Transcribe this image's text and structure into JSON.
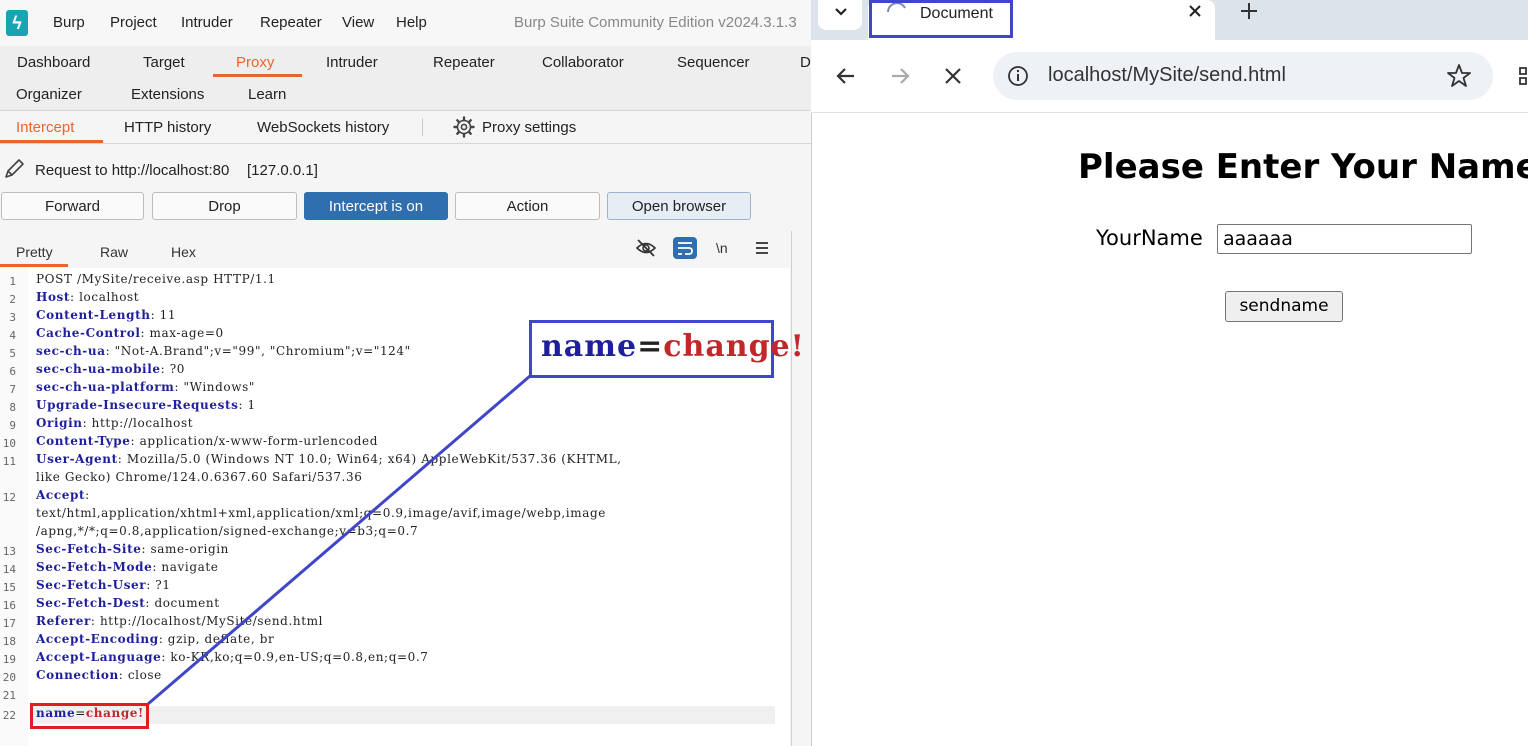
{
  "burp": {
    "title": "Burp Suite Community Edition v2024.3.1.3",
    "menu": [
      "Burp",
      "Project",
      "Intruder",
      "Repeater",
      "View",
      "Help"
    ],
    "main_tabs_row1": [
      "Dashboard",
      "Target",
      "Proxy",
      "Intruder",
      "Repeater",
      "Collaborator",
      "Sequencer",
      "D"
    ],
    "main_tabs_row2": [
      "Organizer",
      "Extensions",
      "Learn"
    ],
    "active_main_tab": "Proxy",
    "sub_tabs": [
      "Intercept",
      "HTTP history",
      "WebSockets history"
    ],
    "proxy_settings": "Proxy settings",
    "request_to": "Request to http://localhost:80",
    "request_ip": "[127.0.0.1]",
    "buttons": {
      "forward": "Forward",
      "drop": "Drop",
      "intercept": "Intercept is on",
      "action": "Action",
      "open_browser": "Open browser"
    },
    "editor_tabs": [
      "Pretty",
      "Raw",
      "Hex"
    ],
    "newline_toggle": "\\n",
    "request_lines": [
      {
        "n": "1",
        "text": "POST /MySite/receive.asp HTTP/1.1"
      },
      {
        "n": "2",
        "key": "Host",
        "val": "localhost"
      },
      {
        "n": "3",
        "key": "Content-Length",
        "val": "11"
      },
      {
        "n": "4",
        "key": "Cache-Control",
        "val": "max-age=0"
      },
      {
        "n": "5",
        "key": "sec-ch-ua",
        "val": "\"Not-A.Brand\";v=\"99\", \"Chromium\";v=\"124\""
      },
      {
        "n": "6",
        "key": "sec-ch-ua-mobile",
        "val": "?0"
      },
      {
        "n": "7",
        "key": "sec-ch-ua-platform",
        "val": "\"Windows\""
      },
      {
        "n": "8",
        "key": "Upgrade-Insecure-Requests",
        "val": "1"
      },
      {
        "n": "9",
        "key": "Origin",
        "val": "http://localhost"
      },
      {
        "n": "10",
        "key": "Content-Type",
        "val": "application/x-www-form-urlencoded"
      },
      {
        "n": "11",
        "key": "User-Agent",
        "val": "Mozilla/5.0 (Windows NT 10.0; Win64; x64) AppleWebKit/537.36 (KHTML,"
      },
      {
        "n": "",
        "text": "like Gecko) Chrome/124.0.6367.60 Safari/537.36"
      },
      {
        "n": "12",
        "key": "Accept",
        "val": ""
      },
      {
        "n": "",
        "text": "text/html,application/xhtml+xml,application/xml;q=0.9,image/avif,image/webp,image"
      },
      {
        "n": "",
        "text": "/apng,*/*;q=0.8,application/signed-exchange;v=b3;q=0.7"
      },
      {
        "n": "13",
        "key": "Sec-Fetch-Site",
        "val": "same-origin"
      },
      {
        "n": "14",
        "key": "Sec-Fetch-Mode",
        "val": "navigate"
      },
      {
        "n": "15",
        "key": "Sec-Fetch-User",
        "val": "?1"
      },
      {
        "n": "16",
        "key": "Sec-Fetch-Dest",
        "val": "document"
      },
      {
        "n": "17",
        "key": "Referer",
        "val": "http://localhost/MySite/send.html"
      },
      {
        "n": "18",
        "key": "Accept-Encoding",
        "val": "gzip, deflate, br"
      },
      {
        "n": "19",
        "key": "Accept-Language",
        "val": "ko-KR,ko;q=0.9,en-US;q=0.8,en;q=0.7"
      },
      {
        "n": "20",
        "key": "Connection",
        "val": "close"
      },
      {
        "n": "21",
        "text": ""
      }
    ],
    "body_line": {
      "n": "22",
      "param": "name",
      "eq": "=",
      "value": "change!"
    },
    "zoom_callout": {
      "param": "name",
      "eq": "=",
      "value": "change!"
    }
  },
  "browser": {
    "tab_title": "Document",
    "url": "localhost/MySite/send.html",
    "page": {
      "heading": "Please Enter Your Name",
      "label": "YourName",
      "input_value": "aaaaaa",
      "button": "sendname"
    }
  },
  "colors": {
    "burp_accent": "#e9652d",
    "intercept_button": "#2f6fb0",
    "annotation_blue": "#4046c8",
    "annotation_red": "#e31b23"
  }
}
